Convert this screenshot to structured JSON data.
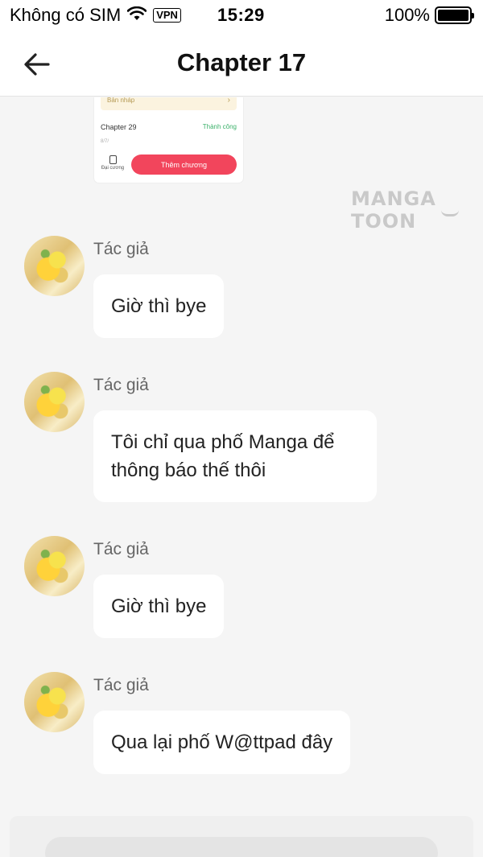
{
  "status_bar": {
    "carrier": "Không có SIM",
    "vpn": "VPN",
    "time": "15:29",
    "battery": "100%",
    "battery_level_pct": 100
  },
  "header": {
    "title": "Chapter 17",
    "back_icon": "arrow-left-icon"
  },
  "screenshot_card": {
    "draft_label": "Bản nháp",
    "chapter": "Chapter 29",
    "status": "Thành công",
    "small_text": "8/7/",
    "outline_label": "Đại cương",
    "add_button": "Thêm chương"
  },
  "watermark": "MANGA TOON",
  "messages": [
    {
      "author": "Tác giả",
      "text": "Giờ thì bye"
    },
    {
      "author": "Tác giả",
      "text_lines": [
        "Tôi chỉ qua phố Manga để",
        "thông báo thế thôi"
      ]
    },
    {
      "author": "Tác giả",
      "text": "Giờ thì bye"
    },
    {
      "author": "Tác giả",
      "text": "Qua lại phố W@ttpad đây"
    }
  ],
  "colors": {
    "accent_red": "#f2455c",
    "success_green": "#3bb16a",
    "background": "#f5f5f5"
  }
}
